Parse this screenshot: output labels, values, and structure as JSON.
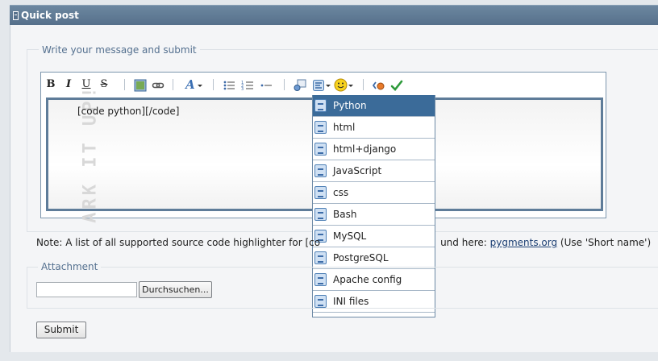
{
  "header": {
    "title": "Quick post"
  },
  "message": {
    "legend": "Write your message and submit",
    "content": "[code python][/code]",
    "watermark": "ARK IT UP!"
  },
  "toolbar": {
    "bold": "B",
    "italic": "I",
    "underline": "U",
    "strike": "S",
    "font": "A"
  },
  "code_menu": {
    "items": [
      {
        "label": "Python",
        "selected": true
      },
      {
        "label": "html"
      },
      {
        "label": "html+django"
      },
      {
        "label": "JavaScript"
      },
      {
        "label": "css"
      },
      {
        "label": "Bash"
      },
      {
        "label": "MySQL"
      },
      {
        "label": "PostgreSQL"
      },
      {
        "label": "Apache config"
      },
      {
        "label": "INI files"
      }
    ]
  },
  "note": {
    "before": "Note: A list of all supported source code highlighter for [co",
    "after": "und here: ",
    "link": "pygments.org",
    "suffix": " (Use 'Short name')"
  },
  "attachment": {
    "legend": "Attachment",
    "browse_label": "Durchsuchen..."
  },
  "submit_label": "Submit",
  "colors": {
    "header": "#56708b",
    "selected": "#3b6b99",
    "legend": "#54708f"
  }
}
